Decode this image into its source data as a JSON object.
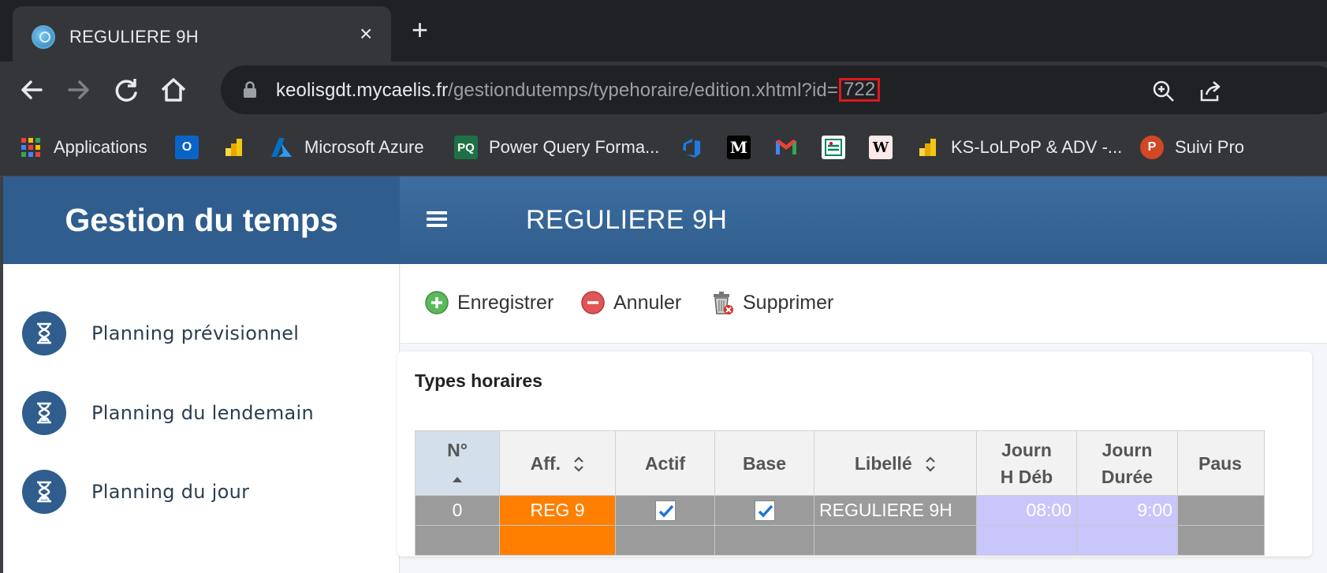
{
  "browser": {
    "tab_title": "REGULIERE 9H",
    "tab_close": "×",
    "new_tab": "+",
    "url_host": "keolisgdt.mycaelis.fr",
    "url_path": "/gestiondutemps/typehoraire/edition.xhtml?id=",
    "url_id": "722",
    "bookmarks": [
      {
        "label": "Applications",
        "icon": "apps-grid-icon"
      },
      {
        "label": "",
        "icon": "outlook-icon"
      },
      {
        "label": "",
        "icon": "powerbi-icon"
      },
      {
        "label": "Microsoft Azure",
        "icon": "azure-icon"
      },
      {
        "label": "Power Query Forma...",
        "icon": "pq-icon",
        "icon_text": "PQ"
      },
      {
        "label": "",
        "icon": "devops-icon"
      },
      {
        "label": "",
        "icon": "lemonde-icon",
        "icon_text": "M"
      },
      {
        "label": "",
        "icon": "gmail-icon"
      },
      {
        "label": "",
        "icon": "credit-agricole-icon"
      },
      {
        "label": "",
        "icon": "wikipedia-icon",
        "icon_text": "W"
      },
      {
        "label": "KS-LoLPoP & ADV -...",
        "icon": "powerbi-icon"
      },
      {
        "label": "Suivi Pro",
        "icon": "powerpoint-icon",
        "icon_text": "P"
      }
    ]
  },
  "app": {
    "brand": "Gestion du temps",
    "page_title": "REGULIERE 9H",
    "sidebar": [
      {
        "label": "Planning prévisionnel"
      },
      {
        "label": "Planning du lendemain"
      },
      {
        "label": "Planning du jour"
      }
    ],
    "actions": {
      "save": "Enregistrer",
      "cancel": "Annuler",
      "delete": "Supprimer"
    },
    "panel_title": "Types horaires",
    "table": {
      "headers": {
        "num": "N°",
        "aff": "Aff.",
        "actif": "Actif",
        "base": "Base",
        "libelle": "Libellé",
        "journ_hdeb_1": "Journ",
        "journ_hdeb_2": "H Déb",
        "journ_duree_1": "Journ",
        "journ_duree_2": "Durée",
        "pause": "Paus"
      },
      "rows": [
        {
          "num": "0",
          "aff": "REG 9",
          "actif": true,
          "base": true,
          "libelle": "REGULIERE 9H",
          "hdeb": "08:00",
          "duree": "9:00",
          "pause": ""
        }
      ]
    },
    "colors": {
      "primary": "#2f5d8e",
      "aff_orange": "#ff7f00",
      "time_lavender": "#c8c6fb",
      "highlight_red": "#e0161d"
    }
  }
}
